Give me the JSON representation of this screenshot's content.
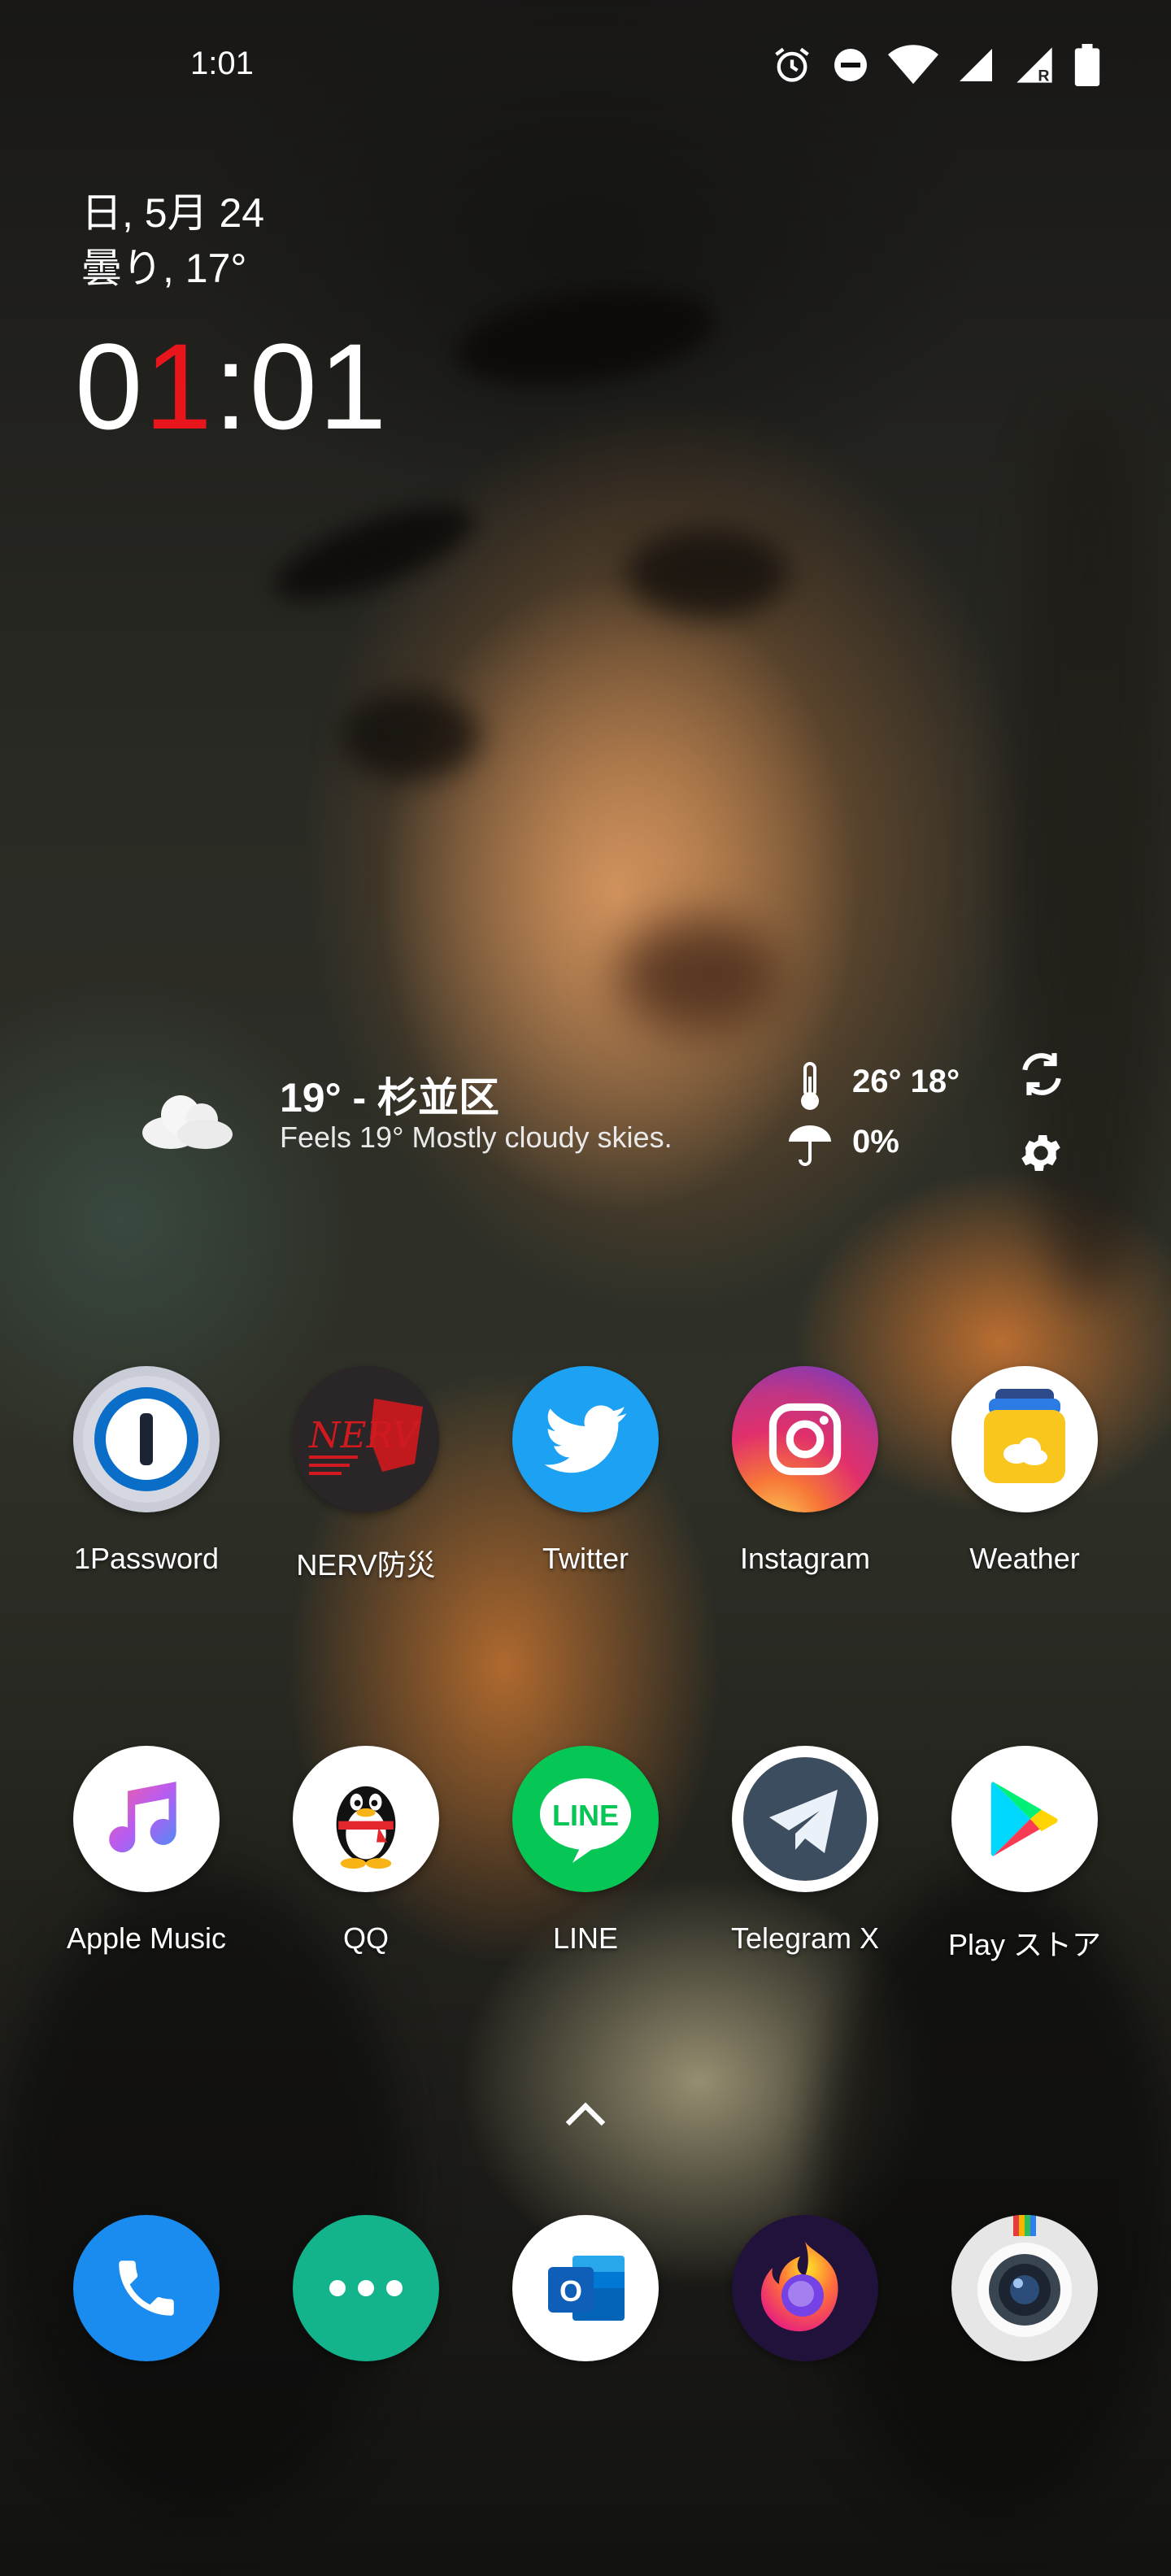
{
  "status_bar": {
    "time": "1:01",
    "icons": [
      "alarm-icon",
      "do-not-disturb-icon",
      "wifi-icon",
      "signal-icon",
      "roaming-signal-icon",
      "battery-icon"
    ]
  },
  "clock_widget": {
    "date": "日, 5月 24",
    "weather": "曇り, 17°",
    "clock_hour_first": "0",
    "clock_hour_second": "1",
    "clock_separator": ":",
    "clock_minutes": "01",
    "accent_color": "#e8161c"
  },
  "weather_widget": {
    "title": "19° - 杉並区",
    "subtitle": "Feels 19° Mostly cloudy skies.",
    "temps": "26° 18°",
    "precip": "0%",
    "icons": [
      "cloud-icon",
      "thermometer-icon",
      "umbrella-icon",
      "refresh-icon",
      "settings-icon"
    ]
  },
  "apps_row1": [
    {
      "label": "1Password"
    },
    {
      "label": "NERV防災"
    },
    {
      "label": "Twitter"
    },
    {
      "label": "Instagram"
    },
    {
      "label": "Weather"
    }
  ],
  "apps_row2": [
    {
      "label": "Apple Music"
    },
    {
      "label": "QQ"
    },
    {
      "label": "LINE"
    },
    {
      "label": "Telegram X"
    },
    {
      "label": "Play ストア"
    }
  ],
  "nerv_logo_text": "NERV",
  "line_logo_text": "LINE",
  "outlook_logo_text": "O",
  "dock": [
    "phone-icon",
    "messages-icon",
    "outlook-icon",
    "firefox-icon",
    "camera-icon"
  ],
  "colors": {
    "twitter": "#1da1f2",
    "line": "#06c755",
    "phone": "#1a8cf0",
    "messages": "#13b38b",
    "weather_yellow": "#f9c61d"
  }
}
